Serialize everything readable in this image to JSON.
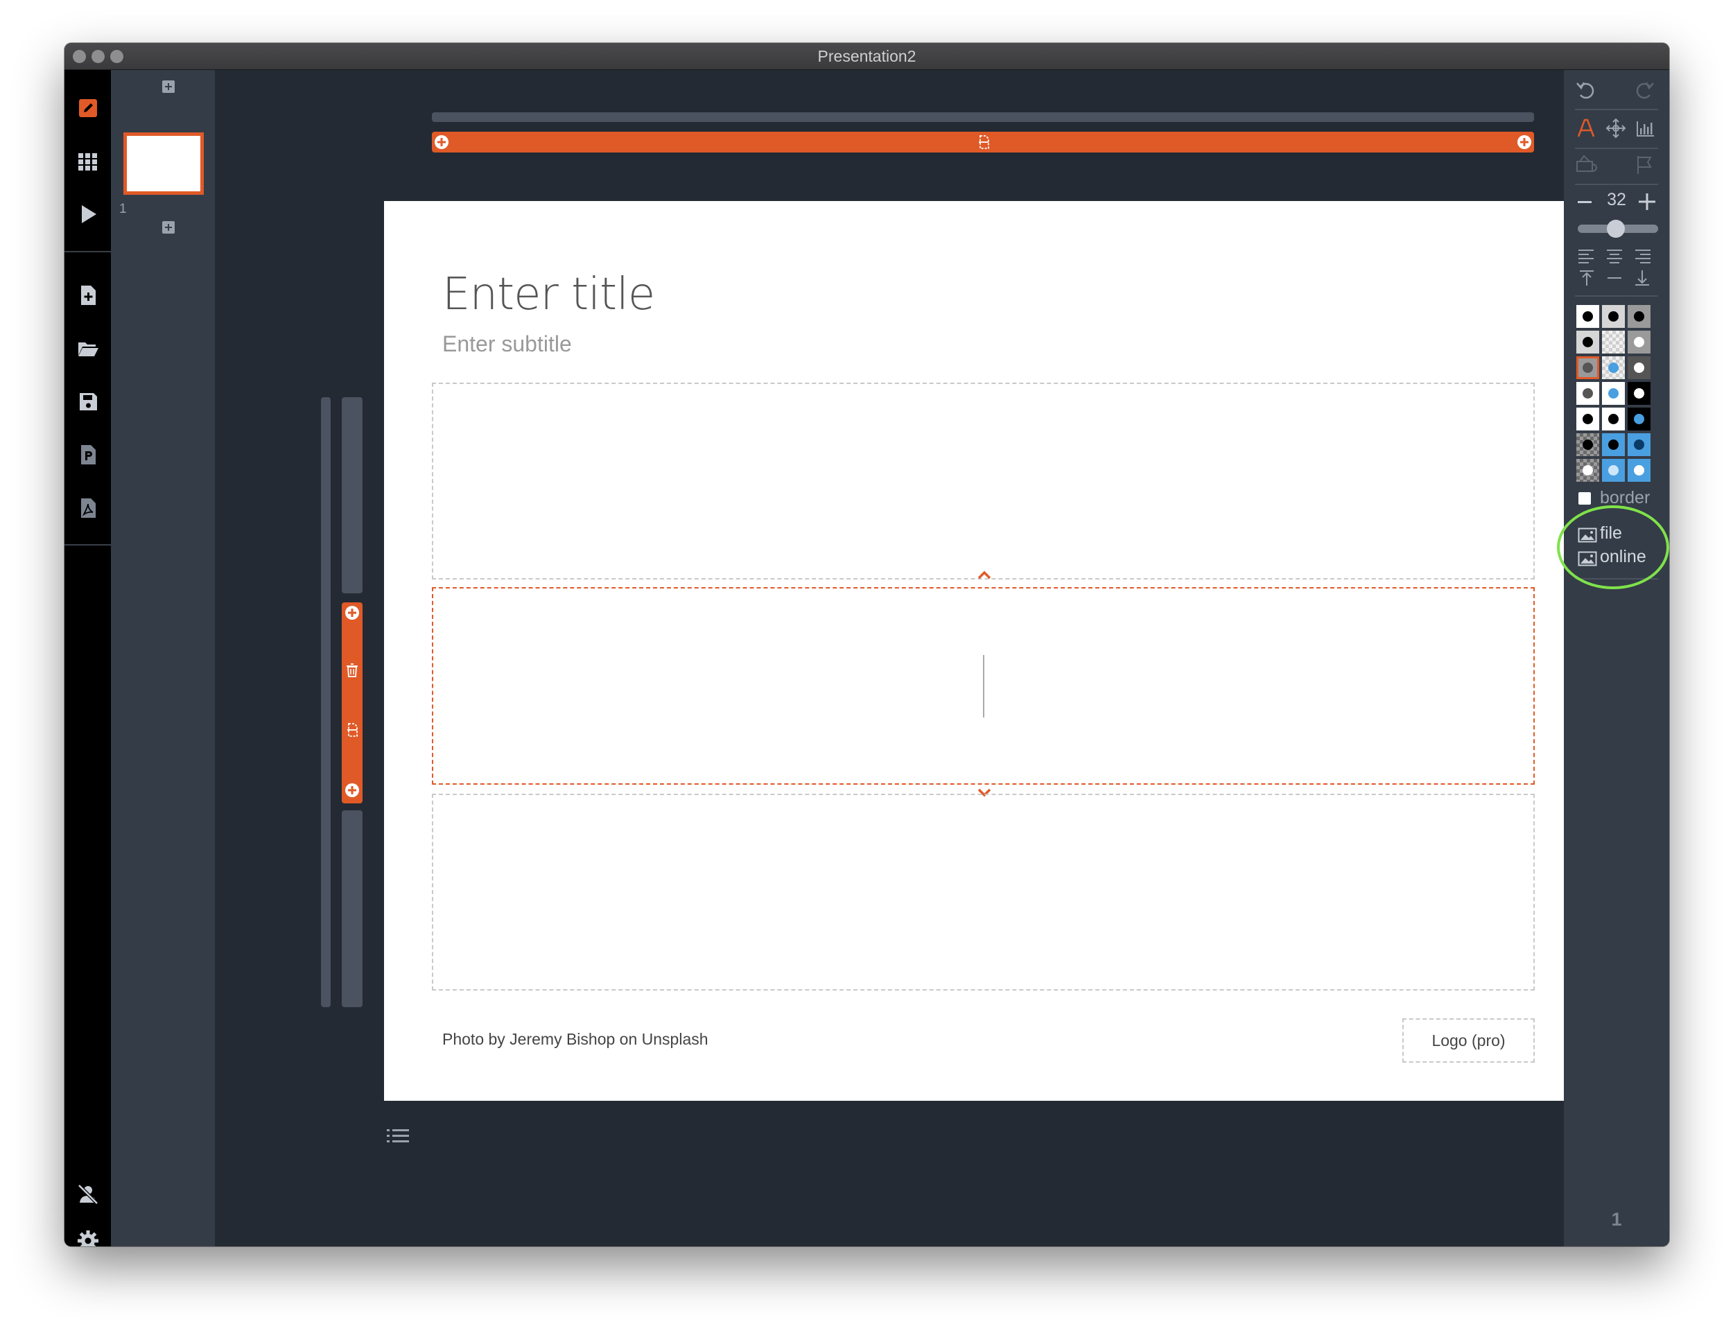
{
  "window": {
    "title": "Presentation2"
  },
  "thumbnails": {
    "slide_number": "1"
  },
  "slide": {
    "title_placeholder": "Enter title",
    "subtitle_placeholder": "Enter subtitle",
    "credit": "Photo by Jeremy Bishop on Unsplash",
    "logo_label": "Logo (pro)"
  },
  "rightpanel": {
    "font_size": "32",
    "border_label": "border",
    "border_checked": false,
    "file_label": "file",
    "online_label": "online",
    "page_number": "1",
    "size_slider_fraction": 0.47
  },
  "colors": {
    "accent": "#e05a28",
    "highlight_circle": "#7fe24a",
    "selected_blue": "#4a9fe0"
  },
  "icons": {
    "left_toolbar": [
      "pencil-icon",
      "grid-icon",
      "play-icon",
      "new-file-icon",
      "folder-open-icon",
      "save-icon",
      "powerpoint-icon",
      "pdf-icon",
      "user-slash-icon",
      "gear-icon"
    ]
  }
}
